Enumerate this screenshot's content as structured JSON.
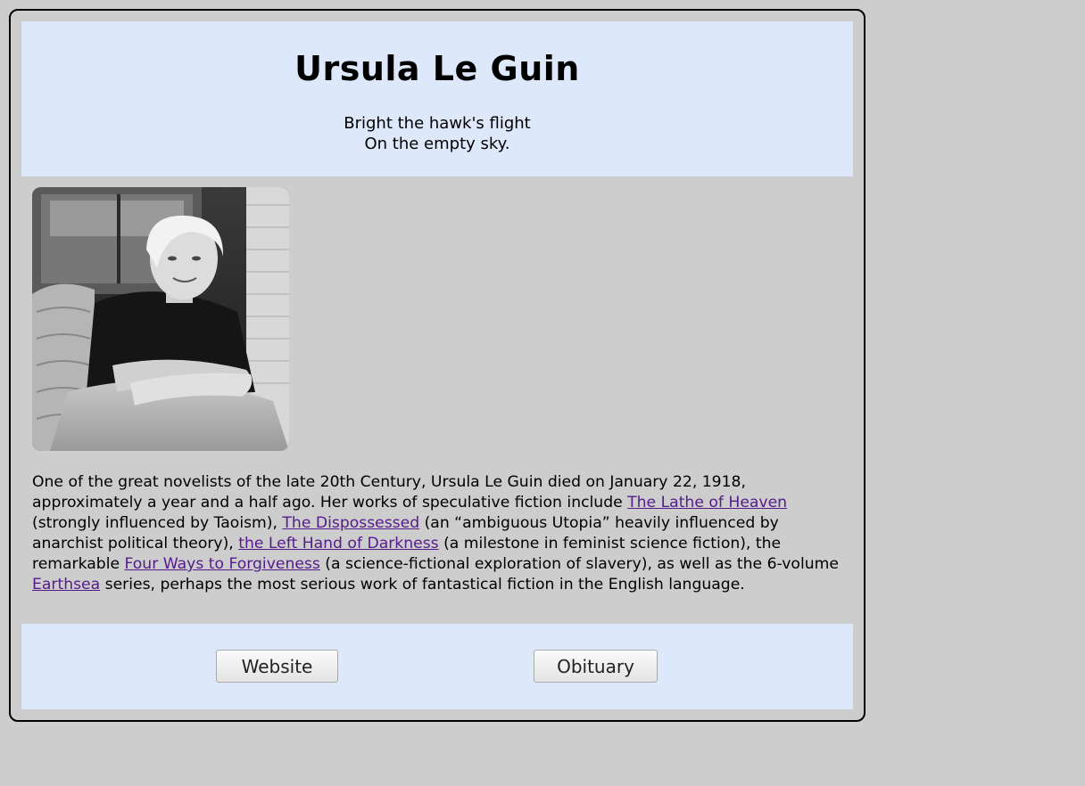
{
  "header": {
    "title": "Ursula Le Guin",
    "poem_line_1": "Bright the hawk's flight",
    "poem_line_2": "On the empty sky."
  },
  "photo": {
    "alt": "Photo of Ursula Le Guin"
  },
  "bio": {
    "text_1": "One of the great novelists of the late 20th Century, Ursula Le Guin died on January 22, 1918, approximately a year and a half ago. Her works of speculative fiction include ",
    "link_1": "The Lathe of Heaven",
    "text_2": " (strongly influenced by Taoism), ",
    "link_2": "The Dispossessed",
    "text_3": " (an “ambiguous Utopia” heavily influenced by anarchist political theory), ",
    "link_3": "the Left Hand of Darkness",
    "text_4": " (a milestone in feminist science fiction), the remarkable ",
    "link_4": "Four Ways to Forgiveness",
    "text_5": " (a science-fictional exploration of slavery), as well as the 6-volume ",
    "link_5": "Earthsea",
    "text_6": " series, perhaps the most serious work of fantastical fiction in the English language."
  },
  "footer": {
    "website_label": "Website",
    "obituary_label": "Obituary"
  },
  "colors": {
    "page_background": "#cdcdcd",
    "panel_background": "#dde8fa",
    "link": "#551a8b"
  }
}
